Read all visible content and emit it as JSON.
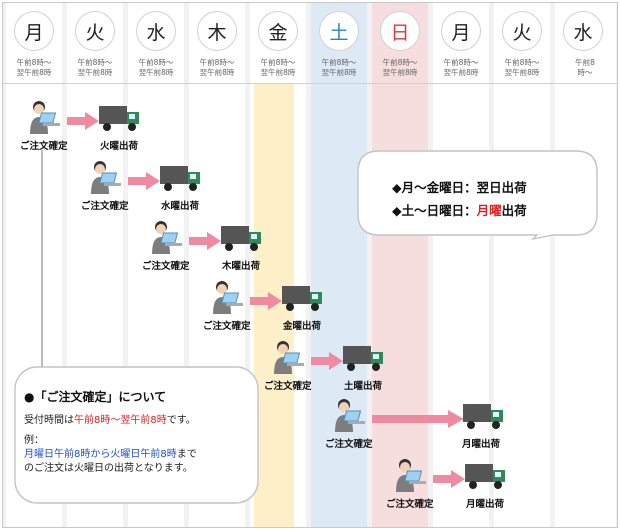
{
  "days": [
    {
      "label": "月",
      "hours": [
        "午前8時〜",
        "翌午前8時"
      ],
      "type": "weekday"
    },
    {
      "label": "火",
      "hours": [
        "午前8時〜",
        "翌午前8時"
      ],
      "type": "weekday"
    },
    {
      "label": "水",
      "hours": [
        "午前8時〜",
        "翌午前8時"
      ],
      "type": "weekday"
    },
    {
      "label": "木",
      "hours": [
        "午前8時〜",
        "翌午前8時"
      ],
      "type": "weekday"
    },
    {
      "label": "金",
      "hours": [
        "午前8時〜",
        "翌午前8時"
      ],
      "type": "friday"
    },
    {
      "label": "土",
      "hours": [
        "午前8時〜",
        "翌午前8時"
      ],
      "type": "saturday"
    },
    {
      "label": "日",
      "hours": [
        "午前8時〜",
        "翌午前8時"
      ],
      "type": "sunday"
    },
    {
      "label": "月",
      "hours": [
        "午前8時〜",
        "翌午前8時"
      ],
      "type": "weekday"
    },
    {
      "label": "火",
      "hours": [
        "午前8時〜",
        "翌午前8時"
      ],
      "type": "weekday"
    },
    {
      "label": "水",
      "hours": [
        "午前8",
        "時〜"
      ],
      "type": "weekday"
    }
  ],
  "steps": [
    {
      "order_label": "ご注文確定",
      "ship_label": "火曜出荷"
    },
    {
      "order_label": "ご注文確定",
      "ship_label": "水曜出荷"
    },
    {
      "order_label": "ご注文確定",
      "ship_label": "木曜出荷"
    },
    {
      "order_label": "ご注文確定",
      "ship_label": "金曜出荷"
    },
    {
      "order_label": "ご注文確定",
      "ship_label": "土曜出荷"
    },
    {
      "order_label": "ご注文確定",
      "ship_label": "月曜出荷"
    },
    {
      "order_label": "ご注文確定",
      "ship_label": "月曜出荷"
    }
  ],
  "summary": {
    "line1_prefix": "◆月〜金曜日：",
    "line1_value": "翌日出荷",
    "line2_prefix": "◆土〜日曜日：",
    "line2_red": "月曜",
    "line2_suffix": "出荷"
  },
  "note": {
    "title": "●「ご注文確定」について",
    "reception_prefix": "受付時間は",
    "reception_red": "午前8時〜翌午前8時",
    "reception_suffix": "です。",
    "example_label": "例：",
    "example_blue": "月曜日午前8時から火曜日午前8時",
    "example_rest1": "まで",
    "example_line2": "のご注文は火曜日の出荷となります。"
  },
  "colors": {
    "saturday": "#2a84cc",
    "sunday": "#e03434",
    "arrow": "#f08aa0",
    "truck_cab": "#2e8b57"
  }
}
